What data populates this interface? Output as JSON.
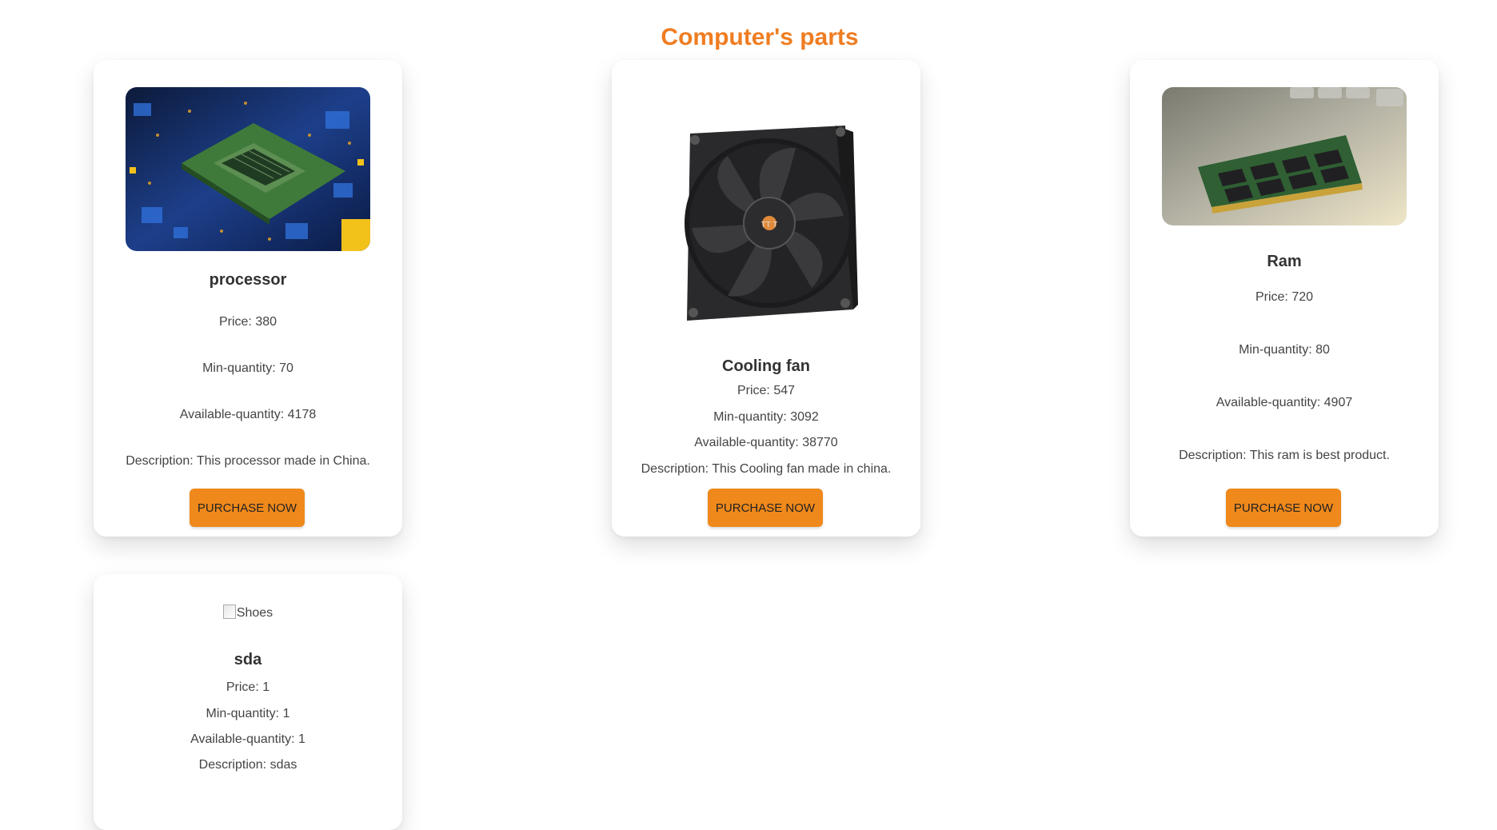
{
  "page": {
    "title": "Computer's parts"
  },
  "products": [
    {
      "name": "processor",
      "price": "Price: 380",
      "min_quantity": "Min-quantity: 70",
      "available_quantity": "Available-quantity: 4178",
      "description": "Description: This processor made in China.",
      "button_label": "PURCHASE NOW",
      "image_icon": "cpu-chip-image"
    },
    {
      "name": "Cooling fan",
      "price": "Price: 547",
      "min_quantity": "Min-quantity: 3092",
      "available_quantity": "Available-quantity: 38770",
      "description": "Description: This Cooling fan made in china.",
      "button_label": "PURCHASE NOW",
      "image_icon": "cooling-fan-image"
    },
    {
      "name": "Ram",
      "price": "Price: 720",
      "min_quantity": "Min-quantity: 80",
      "available_quantity": "Available-quantity: 4907",
      "description": "Description: This ram is best product.",
      "button_label": "PURCHASE NOW",
      "image_icon": "ram-module-image"
    },
    {
      "name": "sda",
      "image_alt": "Shoes",
      "price": "Price: 1",
      "min_quantity": "Min-quantity: 1",
      "available_quantity": "Available-quantity: 1",
      "description": "Description: sdas",
      "image_icon": "broken-image"
    }
  ],
  "colors": {
    "accent": "#ef7d22",
    "button": "#f0891b",
    "background": "#ffffff"
  }
}
